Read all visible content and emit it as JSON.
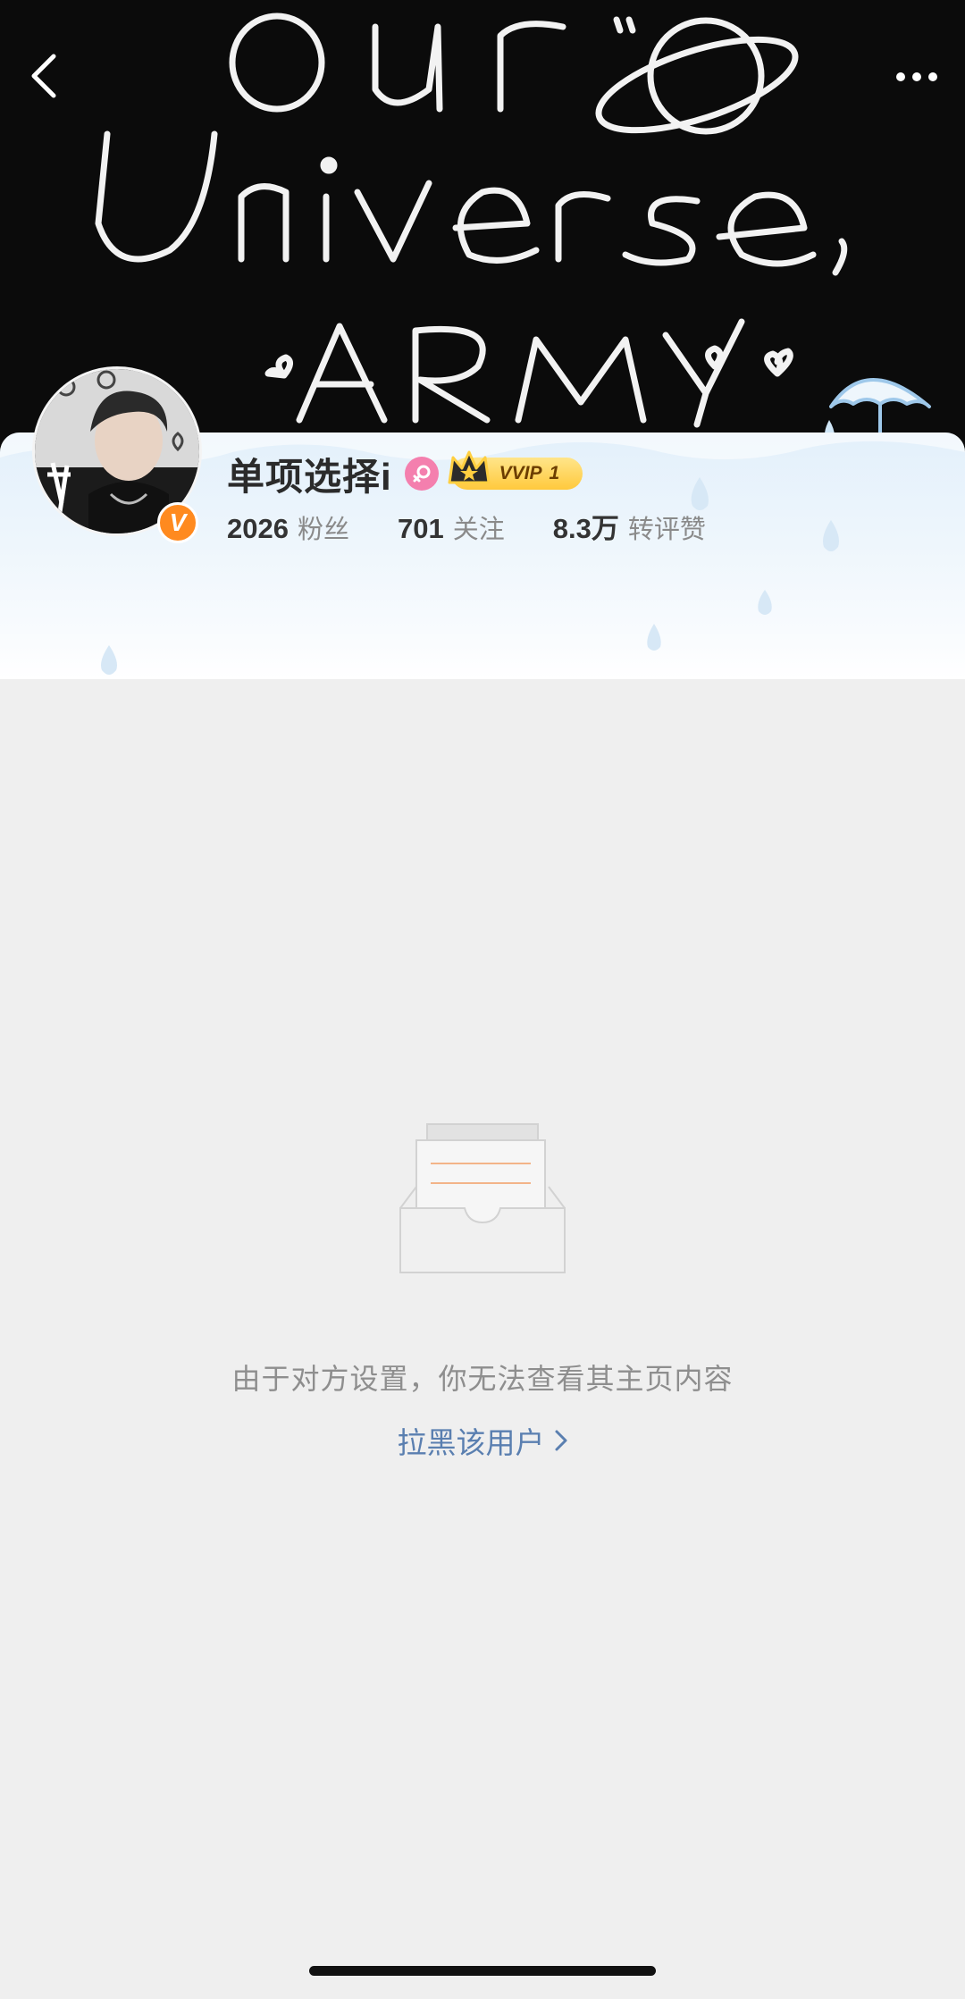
{
  "cover": {
    "line1": "our",
    "line2": "Universe,",
    "line3": "ARMY"
  },
  "nav": {
    "back_icon": "chevron-left-icon",
    "more_icon": "more-dots-icon"
  },
  "profile": {
    "username": "单项选择i",
    "gender": "female",
    "member_badge": "VVIP",
    "member_level": "1",
    "verified_badge": "V"
  },
  "stats": [
    {
      "value": "2026",
      "label": "粉丝"
    },
    {
      "value": "701",
      "label": "关注"
    },
    {
      "value": "8.3万",
      "label": "转评赞"
    }
  ],
  "empty_state": {
    "message": "由于对方设置，你无法查看其主页内容",
    "action_label": "拉黑该用户",
    "action_icon": "chevron-right-icon"
  },
  "colors": {
    "link": "#5a7fb0",
    "gender_badge": "#f47fae",
    "verified_badge": "#ff8a1f",
    "vip_gold": "#ffc93c"
  }
}
